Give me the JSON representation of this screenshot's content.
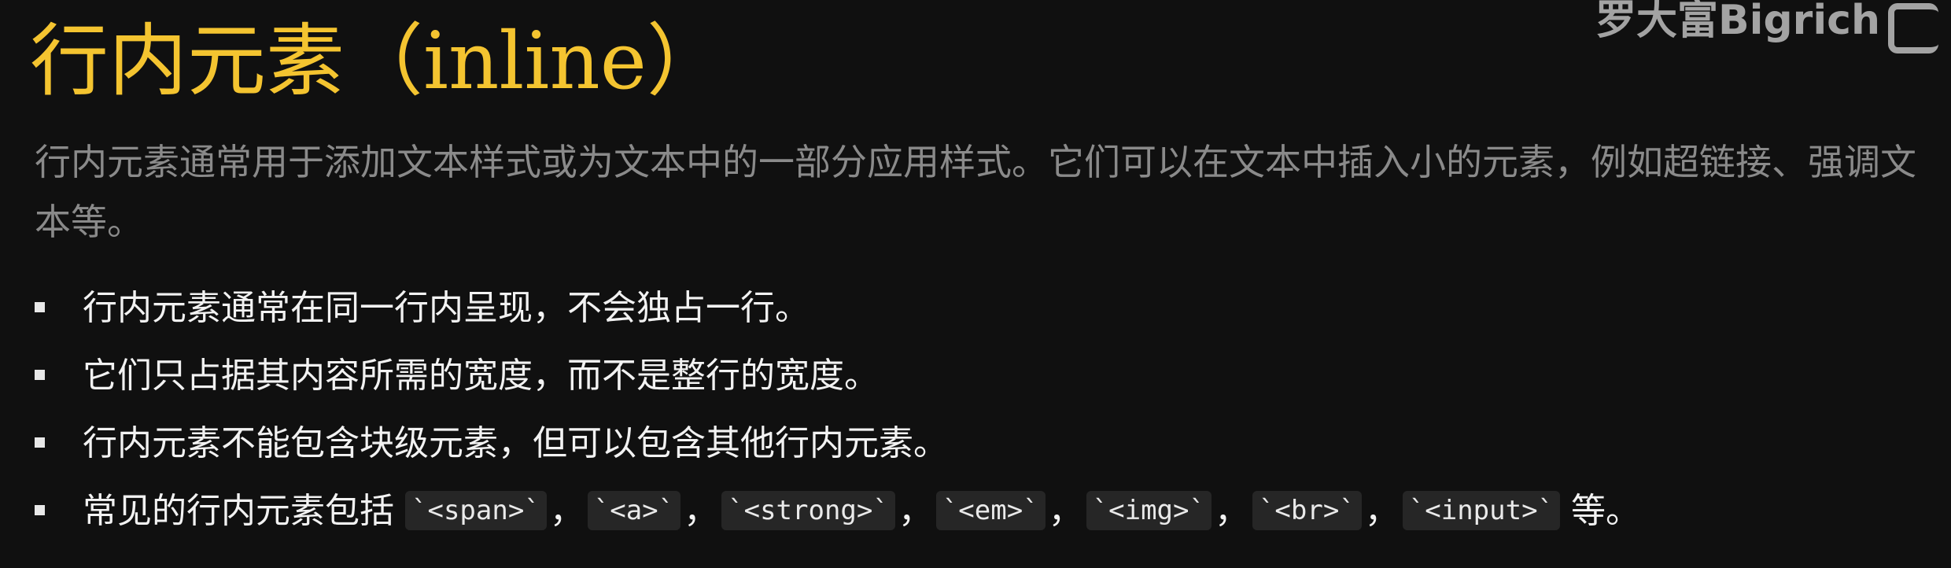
{
  "title": "行内元素（inline）",
  "description": "行内元素通常用于添加文本样式或为文本中的一部分应用样式。它们可以在文本中插入小的元素，例如超链接、强调文本等。",
  "bullets": [
    "行内元素通常在同一行内呈现，不会独占一行。",
    "它们只占据其内容所需的宽度，而不是整行的宽度。",
    "行内元素不能包含块级元素，但可以包含其他行内元素。"
  ],
  "last_bullet": {
    "prefix": "常见的行内元素包括",
    "codes": [
      "`<span>`",
      "`<a>`",
      "`<strong>`",
      "`<em>`",
      "`<img>`",
      "`<br>`",
      "`<input>`"
    ],
    "separator": "，",
    "suffix": "等。"
  },
  "watermark": "罗大富Bigrich",
  "colors": {
    "background": "#101010",
    "title": "#f4c430",
    "description": "#8a8a8a",
    "text": "#f2f2f2"
  }
}
